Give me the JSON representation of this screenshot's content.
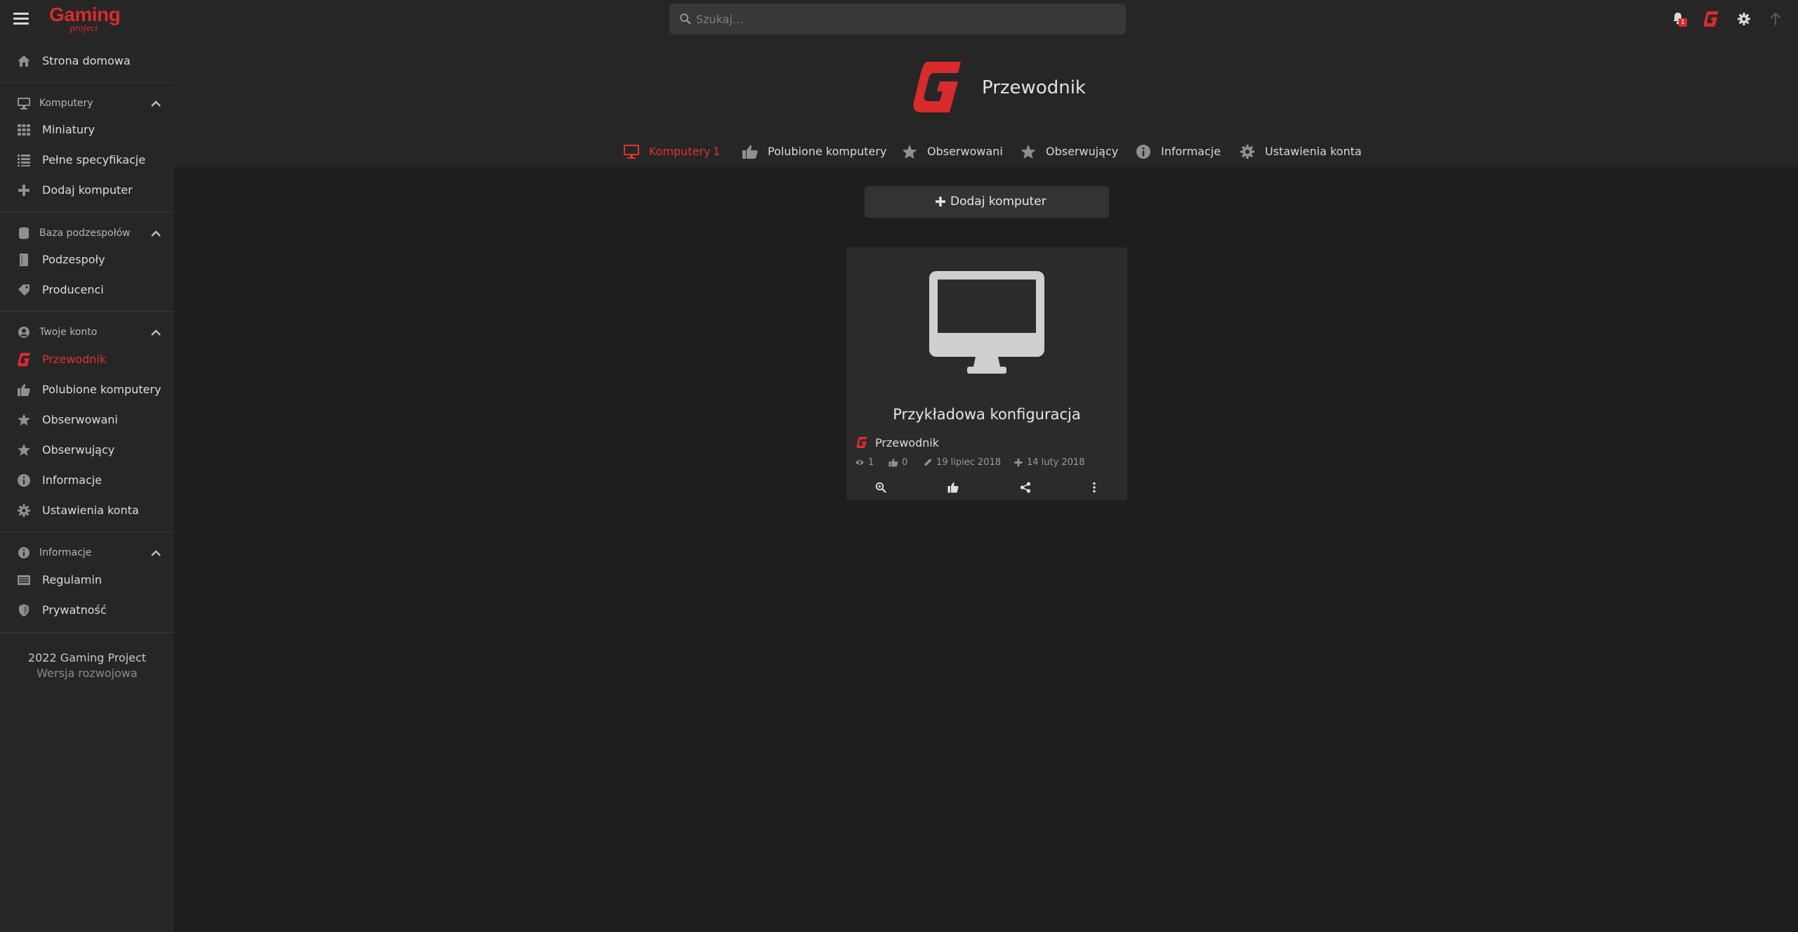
{
  "logo": {
    "main": "Gaming",
    "sub": "project"
  },
  "search": {
    "placeholder": "Szukaj..."
  },
  "topbar": {
    "notification_count": "1"
  },
  "sidebar": {
    "home": "Strona domowa",
    "sections": {
      "computers": {
        "title": "Komputery",
        "items": [
          "Miniatury",
          "Pełne specyfikacje",
          "Dodaj komputer"
        ]
      },
      "parts": {
        "title": "Baza podzespołów",
        "items": [
          "Podzespoły",
          "Producenci"
        ]
      },
      "account": {
        "title": "Twoje konto",
        "items": [
          "Przewodnik",
          "Polubione komputery",
          "Obserwowani",
          "Obserwujący",
          "Informacje",
          "Ustawienia konta"
        ]
      },
      "info": {
        "title": "Informacje",
        "items": [
          "Regulamin",
          "Prywatność"
        ]
      }
    },
    "footer": {
      "line1": "2022 Gaming Project",
      "line2": "Wersja rozwojowa"
    }
  },
  "profile": {
    "name": "Przewodnik",
    "tabs": [
      {
        "label": "Komputery",
        "count": "1"
      },
      {
        "label": "Polubione komputery"
      },
      {
        "label": "Obserwowani"
      },
      {
        "label": "Obserwujący"
      },
      {
        "label": "Informacje"
      },
      {
        "label": "Ustawienia konta"
      }
    ]
  },
  "content": {
    "add_button": "Dodaj komputer",
    "card": {
      "title": "Przykładowa konfiguracja",
      "author": "Przewodnik",
      "views": "1",
      "likes": "0",
      "edited": "19 lipiec 2018",
      "created": "14 luty 2018"
    }
  },
  "colors": {
    "accent": "#e03131",
    "background": "#1e1e1e",
    "panel": "#262626"
  }
}
